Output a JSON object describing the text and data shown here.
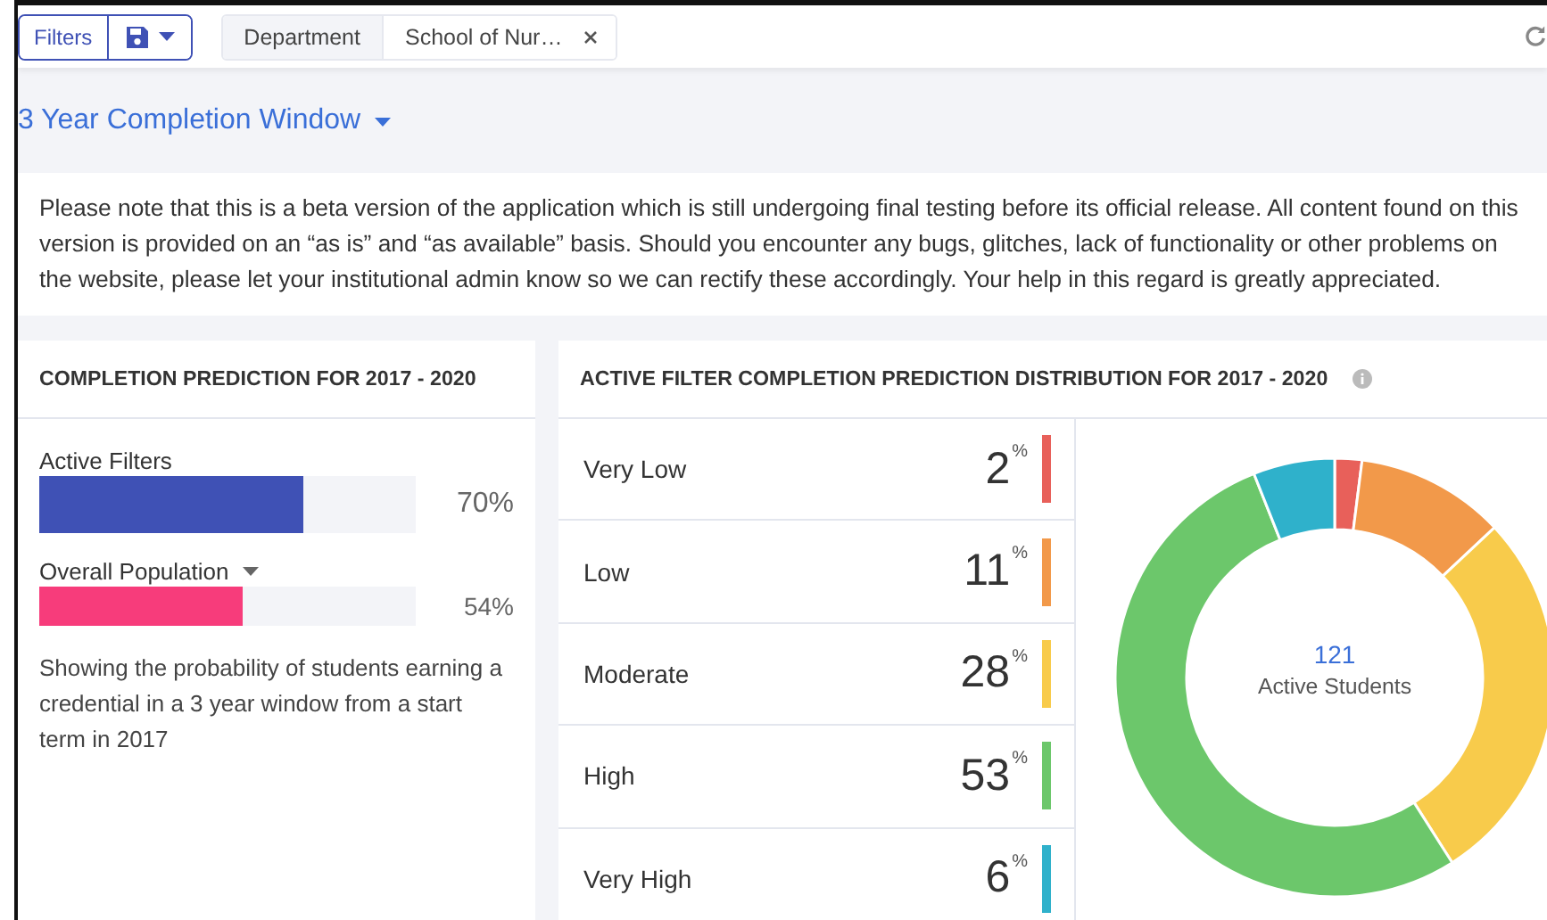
{
  "toolbar": {
    "filters_button": "Filters",
    "filter_chip": {
      "label": "Department",
      "value": "School of Nur…"
    }
  },
  "title": "3 Year Completion Window",
  "notice": "Please note that this is a beta version of the application which is still undergoing final testing before its official release. All content found on this version is provided on an “as is” and “as available” basis. Should you encounter any bugs, glitches, lack of functionality or other problems on the website, please let your institutional admin know so we can rectify these accordingly. Your help in this regard is greatly appreciated.",
  "prediction_card": {
    "title": "COMPLETION PREDICTION FOR 2017 - 2020",
    "bars": [
      {
        "kind": "primary",
        "label": "Active Filters",
        "dropdown": false,
        "level": 0.7,
        "reading": "70%",
        "color": "#3f51b5"
      },
      {
        "kind": "secondary",
        "label": "Overall Population",
        "dropdown": true,
        "level": 0.54,
        "reading": "54%",
        "color": "#f73c7b"
      }
    ],
    "description": "Showing the probability of students earning a credential in a 3 year window from a start term in 2017"
  },
  "distribution_card": {
    "title": "ACTIVE FILTER COMPLETION PREDICTION DISTRIBUTION FOR 2017 - 2020",
    "rows": [
      {
        "label": "Very Low",
        "value": "2",
        "unit": "%",
        "color": "#e8605a"
      },
      {
        "label": "Low",
        "value": "11",
        "unit": "%",
        "color": "#f2994a"
      },
      {
        "label": "Moderate",
        "value": "28",
        "unit": "%",
        "color": "#f8cb4b"
      },
      {
        "label": "High",
        "value": "53",
        "unit": "%",
        "color": "#6cc76b"
      },
      {
        "label": "Very High",
        "value": "6",
        "unit": "%",
        "color": "#2fb1cb"
      }
    ],
    "donut": {
      "count": "121",
      "caption": "Active Students",
      "chart_data": {
        "type": "donut",
        "values": [
          2,
          11,
          28,
          53,
          6
        ],
        "colors": [
          "#e8605a",
          "#f2994a",
          "#f8cb4b",
          "#6cc76b",
          "#2fb1cb"
        ]
      }
    }
  }
}
